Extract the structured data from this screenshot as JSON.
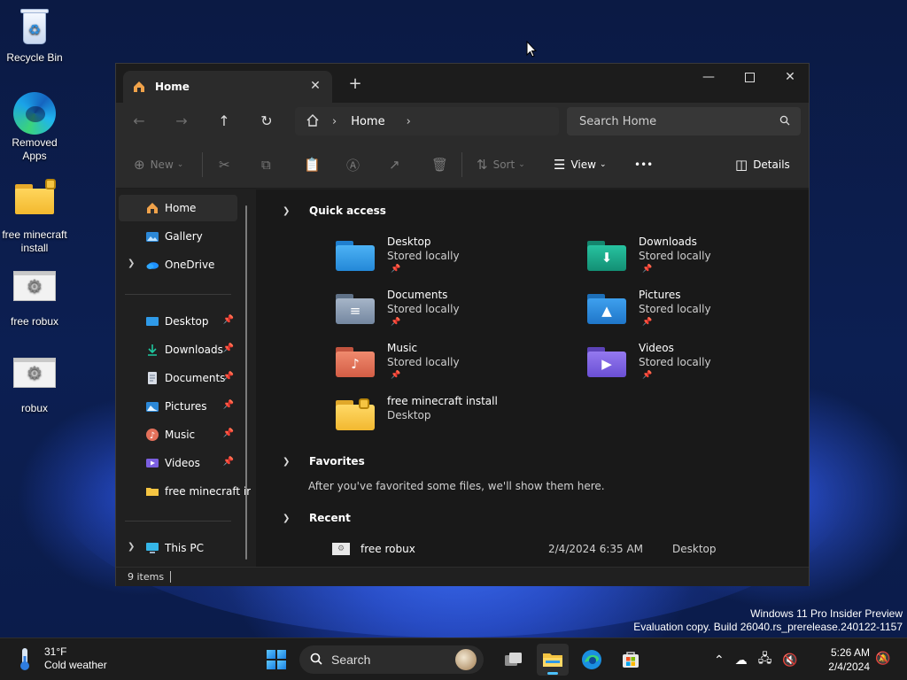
{
  "desktop": {
    "icons": [
      {
        "label": "Recycle Bin",
        "icon": "recycle-bin-icon"
      },
      {
        "label": "Removed Apps",
        "icon": "edge-icon"
      },
      {
        "label": "free minecraft install",
        "icon": "locked-folder-icon"
      },
      {
        "label": "free robux",
        "icon": "settings-file-icon"
      },
      {
        "label": "robux",
        "icon": "settings-file-icon"
      }
    ]
  },
  "explorer": {
    "tab_title": "Home",
    "new_tab_label": "+",
    "breadcrumb": "Home",
    "search_placeholder": "Search Home",
    "commands": {
      "new": "New",
      "sort": "Sort",
      "view": "View",
      "more": "•••",
      "details": "Details"
    },
    "nav": {
      "top": [
        "Home",
        "Gallery",
        "OneDrive"
      ],
      "pinned": [
        "Desktop",
        "Downloads",
        "Documents",
        "Pictures",
        "Music",
        "Videos",
        "free minecraft ir"
      ],
      "this_pc": "This PC"
    },
    "sections": {
      "quick_access": "Quick access",
      "favorites": "Favorites",
      "recent": "Recent"
    },
    "quick_access": [
      {
        "name": "Desktop",
        "sub": "Stored locally",
        "color": "#2f9ae8"
      },
      {
        "name": "Downloads",
        "sub": "Stored locally",
        "color": "#1aa68a"
      },
      {
        "name": "Documents",
        "sub": "Stored locally",
        "color": "#7b8fa8"
      },
      {
        "name": "Pictures",
        "sub": "Stored locally",
        "color": "#2b88d8"
      },
      {
        "name": "Music",
        "sub": "Stored locally",
        "color": "#e3705a"
      },
      {
        "name": "Videos",
        "sub": "Stored locally",
        "color": "#7b5fe0"
      },
      {
        "name": "free minecraft install",
        "sub": "Desktop",
        "color": "#f5c542"
      }
    ],
    "favorites_note": "After you've favorited some files, we'll show them here.",
    "recent": [
      {
        "name": "free robux",
        "date": "2/4/2024 6:35 AM",
        "location": "Desktop"
      }
    ],
    "status": "9 items"
  },
  "watermark": {
    "line1": "Windows 11 Pro Insider Preview",
    "line2": "Evaluation copy. Build 26040.rs_prerelease.240122-1157"
  },
  "taskbar": {
    "weather_temp": "31°F",
    "weather_desc": "Cold weather",
    "search_label": "Search",
    "time": "5:26 AM",
    "date": "2/4/2024"
  }
}
